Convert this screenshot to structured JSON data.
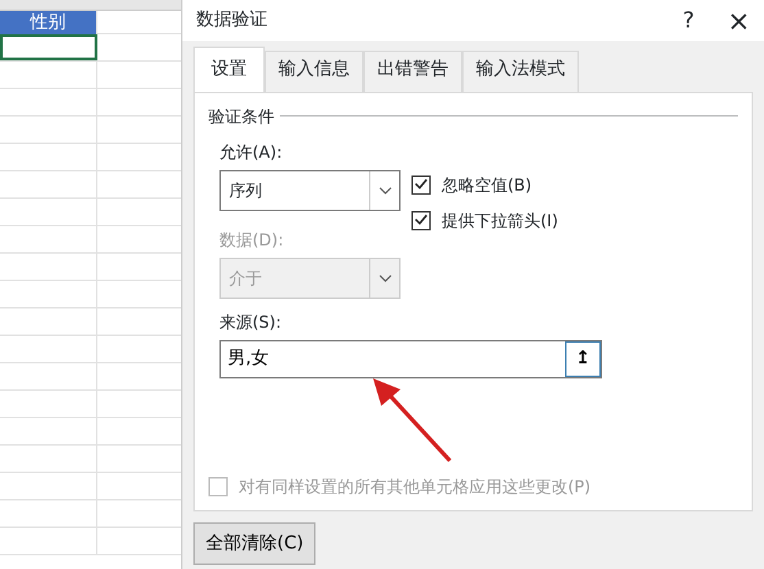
{
  "sheet": {
    "header_cell": "性别",
    "selected_row": true
  },
  "dialog": {
    "title": "数据验证",
    "help": "?",
    "close": "×",
    "tabs": [
      {
        "label": "设置",
        "selected": true
      },
      {
        "label": "输入信息",
        "selected": false
      },
      {
        "label": "出错警告",
        "selected": false
      },
      {
        "label": "输入法模式",
        "selected": false
      }
    ],
    "group_title": "验证条件",
    "allow": {
      "label": "允许(A):",
      "value": "序列",
      "disabled": false
    },
    "data": {
      "label": "数据(D):",
      "value": "介于",
      "disabled": true
    },
    "options": [
      {
        "label": "忽略空值(B)",
        "checked": true
      },
      {
        "label": "提供下拉箭头(I)",
        "checked": true
      }
    ],
    "source": {
      "label": "来源(S):",
      "value": "男,女",
      "button": "↥"
    },
    "apply_all": {
      "label": "对有同样设置的所有其他单元格应用这些更改(P)",
      "checked": false,
      "disabled": true
    },
    "clear_button": "全部清除(C)"
  }
}
